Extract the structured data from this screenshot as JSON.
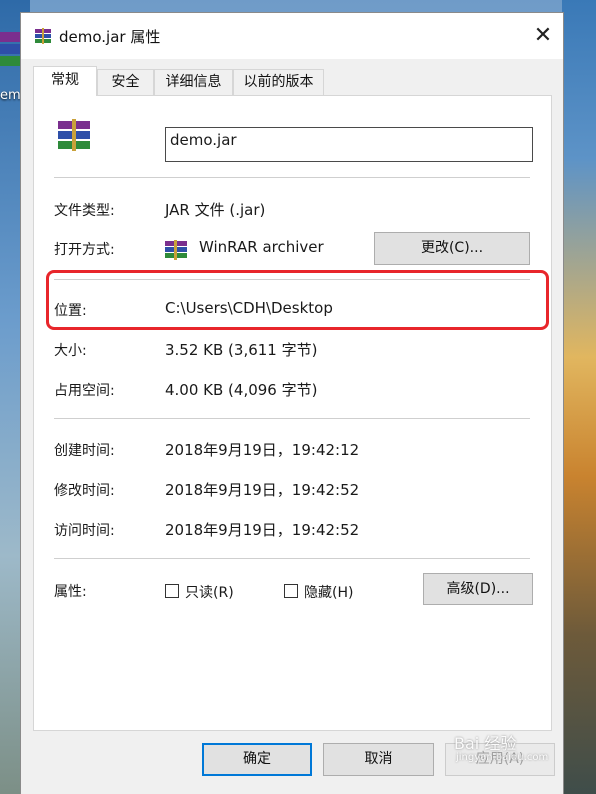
{
  "desktop": {
    "icon_label": "em"
  },
  "window": {
    "title": "demo.jar 属性",
    "close_glyph": "✕"
  },
  "tabs": [
    {
      "label": "常规",
      "active": true
    },
    {
      "label": "安全",
      "active": false
    },
    {
      "label": "详细信息",
      "active": false
    },
    {
      "label": "以前的版本",
      "active": false
    }
  ],
  "general": {
    "file_name": "demo.jar",
    "file_type_label": "文件类型:",
    "file_type_value": "JAR 文件 (.jar)",
    "opens_with_label": "打开方式:",
    "opens_with_value": "WinRAR archiver",
    "change_button": "更改(C)...",
    "location_label": "位置:",
    "location_value": "C:\\Users\\CDH\\Desktop",
    "size_label": "大小:",
    "size_value": "3.52 KB (3,611 字节)",
    "size_on_disk_label": "占用空间:",
    "size_on_disk_value": "4.00 KB (4,096 字节)",
    "created_label": "创建时间:",
    "created_value": "2018年9月19日，19:42:12",
    "modified_label": "修改时间:",
    "modified_value": "2018年9月19日，19:42:52",
    "accessed_label": "访问时间:",
    "accessed_value": "2018年9月19日，19:42:52",
    "attributes_label": "属性:",
    "readonly_label": "只读(R)",
    "readonly_checked": false,
    "hidden_label": "隐藏(H)",
    "hidden_checked": false,
    "advanced_button": "高级(D)..."
  },
  "footer": {
    "ok_button": "确定",
    "cancel_button": "取消",
    "apply_button": "应用(A)"
  },
  "watermark": {
    "text": "Bai 经验",
    "sub": "jingyan.baidu.com"
  },
  "colors": {
    "highlight": "#e8262b",
    "default_button_border": "#0078d7",
    "dialog_bg": "#f0f0f0"
  }
}
